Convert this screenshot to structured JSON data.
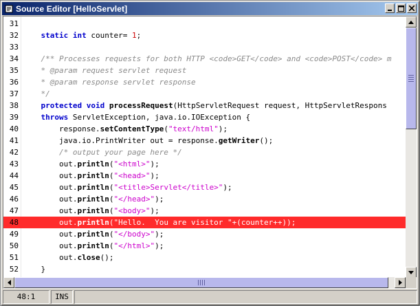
{
  "window": {
    "title": "Source Editor [HelloServlet]",
    "controls": [
      {
        "icon": "minimize-icon"
      },
      {
        "icon": "maximize-icon"
      },
      {
        "icon": "close-icon"
      }
    ]
  },
  "editor": {
    "breakpoint_line": 48,
    "lines": [
      {
        "n": "31",
        "tokens": []
      },
      {
        "n": "32",
        "tokens": [
          [
            "t",
            "    "
          ],
          [
            "kw",
            "static"
          ],
          [
            "t",
            " "
          ],
          [
            "kw",
            "int"
          ],
          [
            "t",
            " counter= "
          ],
          [
            "num",
            "1"
          ],
          [
            "t",
            ";"
          ]
        ]
      },
      {
        "n": "33",
        "tokens": []
      },
      {
        "n": "34",
        "tokens": [
          [
            "t",
            "    "
          ],
          [
            "cm",
            "/** Processes requests for both HTTP <code>GET</code> and <code>POST</code> m"
          ]
        ]
      },
      {
        "n": "35",
        "tokens": [
          [
            "t",
            "    "
          ],
          [
            "cm",
            "* @param request servlet request"
          ]
        ]
      },
      {
        "n": "36",
        "tokens": [
          [
            "t",
            "    "
          ],
          [
            "cm",
            "* @param response servlet response"
          ]
        ]
      },
      {
        "n": "37",
        "tokens": [
          [
            "t",
            "    "
          ],
          [
            "cm",
            "*/"
          ]
        ]
      },
      {
        "n": "38",
        "tokens": [
          [
            "t",
            "    "
          ],
          [
            "kw",
            "protected"
          ],
          [
            "t",
            " "
          ],
          [
            "kw",
            "void"
          ],
          [
            "t",
            " "
          ],
          [
            "mth",
            "processRequest"
          ],
          [
            "t",
            "(HttpServletRequest request, HttpServletRespons"
          ]
        ]
      },
      {
        "n": "39",
        "tokens": [
          [
            "t",
            "    "
          ],
          [
            "kw",
            "throws"
          ],
          [
            "t",
            " ServletException, java.io.IOException {"
          ]
        ]
      },
      {
        "n": "40",
        "tokens": [
          [
            "t",
            "        response."
          ],
          [
            "mth",
            "setContentType"
          ],
          [
            "t",
            "("
          ],
          [
            "str",
            "\"text/html\""
          ],
          [
            "t",
            ");"
          ]
        ]
      },
      {
        "n": "41",
        "tokens": [
          [
            "t",
            "        java.io.PrintWriter out = response."
          ],
          [
            "mth",
            "getWriter"
          ],
          [
            "t",
            "();"
          ]
        ]
      },
      {
        "n": "42",
        "tokens": [
          [
            "t",
            "        "
          ],
          [
            "cm",
            "/* output your page here */"
          ]
        ]
      },
      {
        "n": "43",
        "tokens": [
          [
            "t",
            "        out."
          ],
          [
            "mth",
            "println"
          ],
          [
            "t",
            "("
          ],
          [
            "str",
            "\"<html>\""
          ],
          [
            "t",
            ");"
          ]
        ]
      },
      {
        "n": "44",
        "tokens": [
          [
            "t",
            "        out."
          ],
          [
            "mth",
            "println"
          ],
          [
            "t",
            "("
          ],
          [
            "str",
            "\"<head>\""
          ],
          [
            "t",
            ");"
          ]
        ]
      },
      {
        "n": "45",
        "tokens": [
          [
            "t",
            "        out."
          ],
          [
            "mth",
            "println"
          ],
          [
            "t",
            "("
          ],
          [
            "str",
            "\"<title>Servlet</title>\""
          ],
          [
            "t",
            ");"
          ]
        ]
      },
      {
        "n": "46",
        "tokens": [
          [
            "t",
            "        out."
          ],
          [
            "mth",
            "println"
          ],
          [
            "t",
            "("
          ],
          [
            "str",
            "\"</head>\""
          ],
          [
            "t",
            ");"
          ]
        ]
      },
      {
        "n": "47",
        "tokens": [
          [
            "t",
            "        out."
          ],
          [
            "mth",
            "println"
          ],
          [
            "t",
            "("
          ],
          [
            "str",
            "\"<body>\""
          ],
          [
            "t",
            ");"
          ]
        ]
      },
      {
        "n": "48",
        "tokens": [
          [
            "t",
            "        out."
          ],
          [
            "mth",
            "println"
          ],
          [
            "t",
            "("
          ],
          [
            "str",
            "\"Hello.  You are visitor \""
          ],
          [
            "t",
            "+(counter++));"
          ]
        ]
      },
      {
        "n": "49",
        "tokens": [
          [
            "t",
            "        out."
          ],
          [
            "mth",
            "println"
          ],
          [
            "t",
            "("
          ],
          [
            "str",
            "\"</body>\""
          ],
          [
            "t",
            ");"
          ]
        ]
      },
      {
        "n": "50",
        "tokens": [
          [
            "t",
            "        out."
          ],
          [
            "mth",
            "println"
          ],
          [
            "t",
            "("
          ],
          [
            "str",
            "\"</html>\""
          ],
          [
            "t",
            ");"
          ]
        ]
      },
      {
        "n": "51",
        "tokens": [
          [
            "t",
            "        out."
          ],
          [
            "mth",
            "close"
          ],
          [
            "t",
            "();"
          ]
        ]
      },
      {
        "n": "52",
        "tokens": [
          [
            "t",
            "    }"
          ]
        ]
      }
    ]
  },
  "status": {
    "position": "48:1",
    "mode": "INS",
    "message": ""
  },
  "colors": {
    "title_gradient_start": "#0a246a",
    "title_gradient_end": "#a6caf0",
    "breakpoint": "#ff2b2b",
    "keyword": "#0000cc",
    "string": "#cc00cc",
    "comment": "#8a8a8a",
    "number": "#cc0000"
  }
}
